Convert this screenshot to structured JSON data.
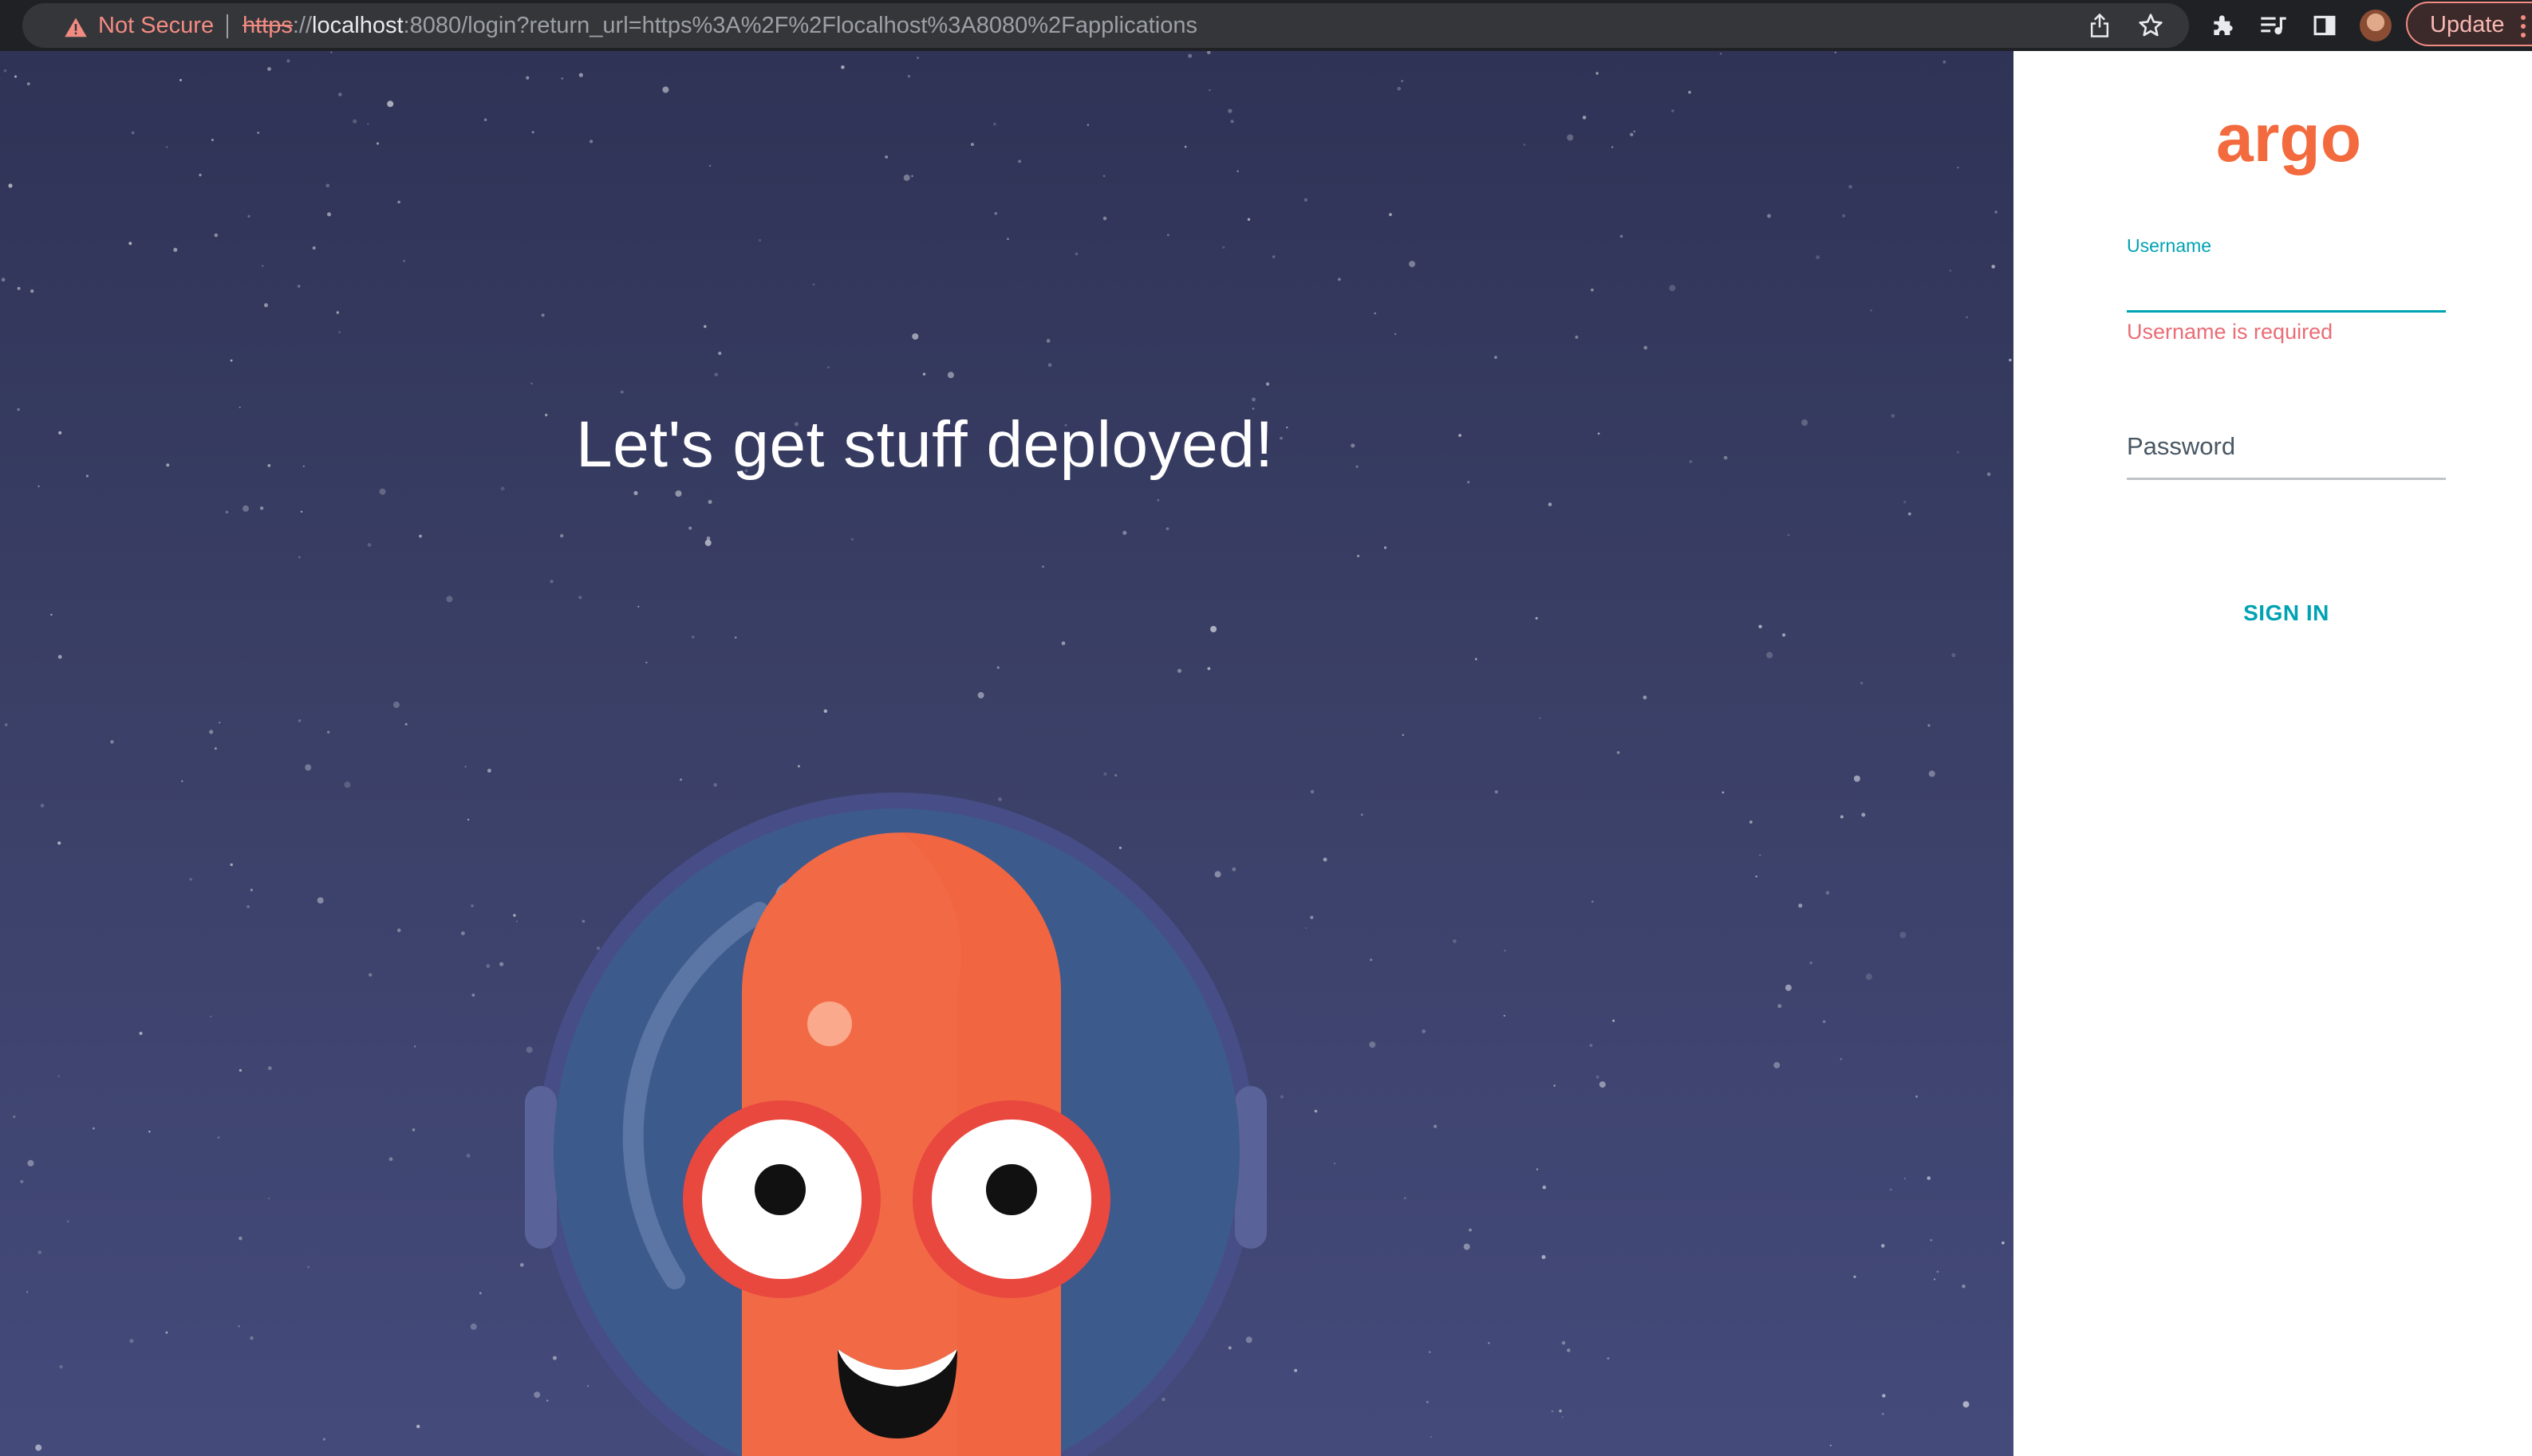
{
  "browser": {
    "security_label": "Not Secure",
    "url": {
      "scheme": "https",
      "separator": "://",
      "host": "localhost",
      "rest": ":8080/login?return_url=https%3A%2F%2Flocalhost%3A8080%2Fapplications"
    },
    "update_label": "Update",
    "icons": [
      "warning-icon",
      "share-icon",
      "bookmark-star-icon",
      "extensions-icon",
      "media-playlist-icon",
      "side-panel-icon",
      "profile-avatar",
      "more-menu-icon"
    ]
  },
  "hero": {
    "tagline": "Let's get stuff deployed!"
  },
  "login": {
    "logo_text": "argo",
    "username": {
      "label": "Username",
      "value": "",
      "error": "Username is required"
    },
    "password": {
      "placeholder": "Password",
      "value": ""
    },
    "sign_in_label": "SIGN IN"
  },
  "colors": {
    "accent": "#00a2b3",
    "error": "#e96d76",
    "brand_orange": "#f26a3d",
    "hero_bg": "#3a3f66",
    "chrome_bg": "#202124"
  }
}
